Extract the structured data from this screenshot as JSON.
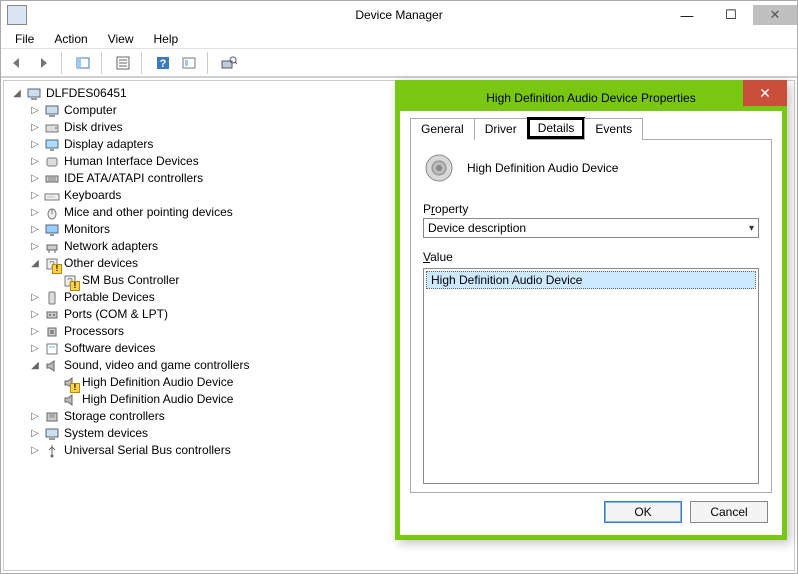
{
  "window": {
    "title": "Device Manager"
  },
  "menu": {
    "file": "File",
    "action": "Action",
    "view": "View",
    "help": "Help"
  },
  "tree": {
    "root": "DLFDES06451",
    "computer": "Computer",
    "disk_drives": "Disk drives",
    "display_adapters": "Display adapters",
    "hid": "Human Interface Devices",
    "ide": "IDE ATA/ATAPI controllers",
    "keyboards": "Keyboards",
    "mice": "Mice and other pointing devices",
    "monitors": "Monitors",
    "network": "Network adapters",
    "other_devices": "Other devices",
    "sm_bus": "SM Bus Controller",
    "portable": "Portable Devices",
    "ports": "Ports (COM & LPT)",
    "processors": "Processors",
    "software": "Software devices",
    "sound": "Sound, video and game controllers",
    "hda1": "High Definition Audio Device",
    "hda2": "High Definition Audio Device",
    "storage": "Storage controllers",
    "system": "System devices",
    "usb": "Universal Serial Bus controllers"
  },
  "dialog": {
    "title": "High Definition Audio Device Properties",
    "tabs": {
      "general": "General",
      "driver": "Driver",
      "details": "Details",
      "events": "Events"
    },
    "device_name": "High Definition Audio Device",
    "property_label_pre": "P",
    "property_label_ul": "r",
    "property_label_post": "operty",
    "property_value": "Device description",
    "value_label_pre": "",
    "value_label_ul": "V",
    "value_label_post": "alue",
    "value_content": "High Definition Audio Device",
    "ok": "OK",
    "cancel": "Cancel"
  }
}
